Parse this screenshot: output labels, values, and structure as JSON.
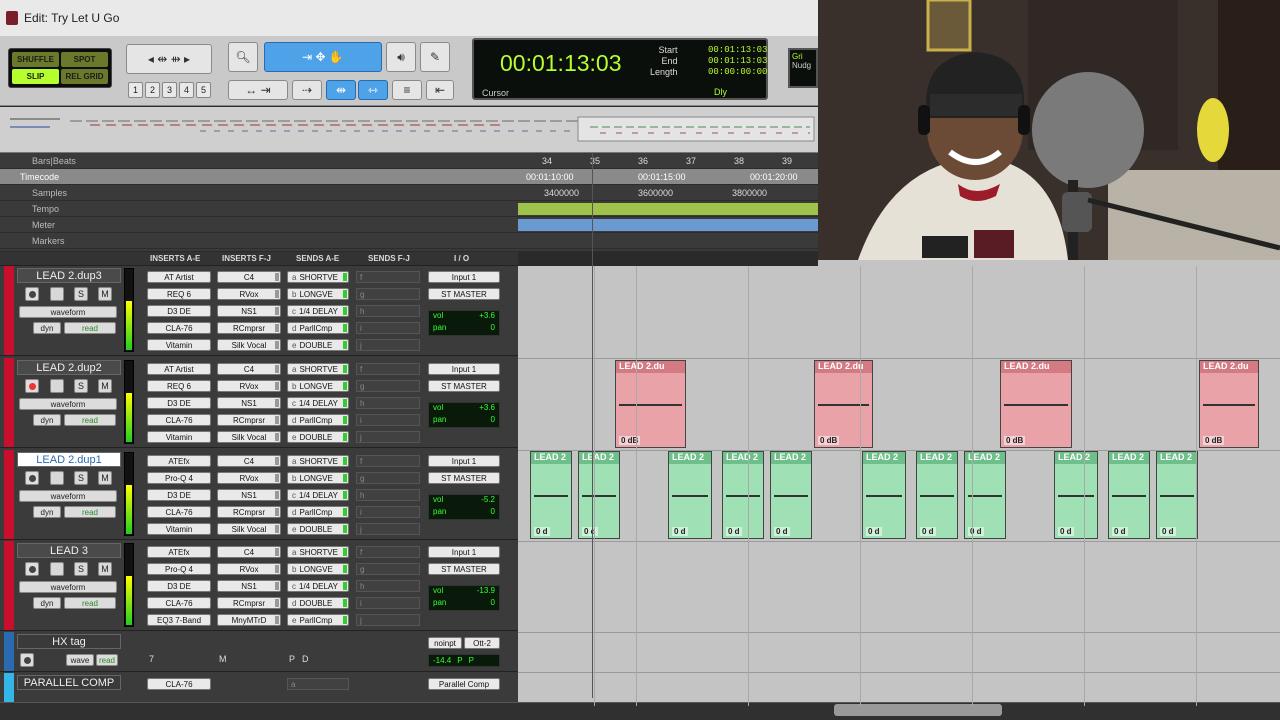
{
  "window": {
    "title": "Edit: Try Let U Go"
  },
  "toolbar": {
    "modes": [
      "SHUFFLE",
      "SPOT",
      "SLIP",
      "REL GRID"
    ],
    "grid_numbers": [
      "1",
      "2",
      "3",
      "4",
      "5"
    ]
  },
  "counter": {
    "main": "00:01:13:03",
    "labels": [
      "Start",
      "End",
      "Length"
    ],
    "values": [
      "00:01:13:03",
      "00:01:13:03",
      "00:00:00:00"
    ],
    "cursor_label": "Cursor",
    "dly_label": "Dly"
  },
  "right_panel": {
    "labels": [
      "Gri",
      "Nudg"
    ]
  },
  "rulers": {
    "rows": [
      "Bars|Beats",
      "Timecode",
      "Samples",
      "Tempo",
      "Meter",
      "Markers"
    ],
    "bars": [
      "34",
      "35",
      "36",
      "37",
      "38",
      "39"
    ],
    "timecodes": [
      "00:01:10:00",
      "00:01:15:00",
      "00:01:20:00"
    ],
    "samples": [
      "3400000",
      "3600000",
      "3800000"
    ]
  },
  "columns": {
    "inserts_ae": "INSERTS A-E",
    "inserts_fj": "INSERTS F-J",
    "sends_ae": "SENDS A-E",
    "sends_fj": "SENDS F-J",
    "io": "I / O"
  },
  "tracks": [
    {
      "name": "LEAD 2.dup3",
      "view": "waveform",
      "dyn": "dyn",
      "auto": "read",
      "ins_a": [
        "AT Artist",
        "REQ 6",
        "D3 DE",
        "CLA-76",
        "Vitamin"
      ],
      "ins_f": [
        "C4",
        "RVox",
        "NS1",
        "RCmprsr",
        "Silk Vocal"
      ],
      "sends": [
        "SHORTVE",
        "LONGVE",
        "1/4 DELAY",
        "ParllCmp",
        "DOUBLE"
      ],
      "send_letters": [
        "a",
        "b",
        "c",
        "d",
        "e"
      ],
      "sends_fj": [
        "f",
        "g",
        "h",
        "i",
        "j"
      ],
      "input": "Input 1",
      "output": "ST MASTER",
      "vol": "+3.6",
      "pan": "0"
    },
    {
      "name": "LEAD 2.dup2",
      "view": "waveform",
      "dyn": "dyn",
      "auto": "read",
      "ins_a": [
        "AT Artist",
        "REQ 6",
        "D3 DE",
        "CLA-76",
        "Vitamin"
      ],
      "ins_f": [
        "C4",
        "RVox",
        "NS1",
        "RCmprsr",
        "Silk Vocal"
      ],
      "sends": [
        "SHORTVE",
        "LONGVE",
        "1/4 DELAY",
        "ParllCmp",
        "DOUBLE"
      ],
      "send_letters": [
        "a",
        "b",
        "c",
        "d",
        "e"
      ],
      "sends_fj": [
        "f",
        "g",
        "h",
        "i",
        "j"
      ],
      "input": "Input 1",
      "output": "ST MASTER",
      "vol": "+3.6",
      "pan": "0"
    },
    {
      "name": "LEAD 2.dup1",
      "view": "waveform",
      "dyn": "dyn",
      "auto": "read",
      "ins_a": [
        "ATEfx",
        "Pro-Q 4",
        "D3 DE",
        "CLA-76",
        "Vitamin"
      ],
      "ins_f": [
        "C4",
        "RVox",
        "NS1",
        "RCmprsr",
        "Silk Vocal"
      ],
      "sends": [
        "SHORTVE",
        "LONGVE",
        "1/4 DELAY",
        "ParllCmp",
        "DOUBLE"
      ],
      "send_letters": [
        "a",
        "b",
        "c",
        "d",
        "e"
      ],
      "sends_fj": [
        "f",
        "g",
        "h",
        "i",
        "j"
      ],
      "input": "Input 1",
      "output": "ST MASTER",
      "vol": "-5.2",
      "pan": "0"
    },
    {
      "name": "LEAD 3",
      "view": "waveform",
      "dyn": "dyn",
      "auto": "read",
      "ins_a": [
        "ATEfx",
        "Pro-Q 4",
        "D3 DE",
        "CLA-76",
        "EQ3 7-Band"
      ],
      "ins_f": [
        "C4",
        "RVox",
        "NS1",
        "RCmprsr",
        "MnyMTrD"
      ],
      "sends": [
        "SHORTVE",
        "LONGVE",
        "1/4 DELAY",
        "DOUBLE",
        "ParllCmp"
      ],
      "send_letters": [
        "a",
        "b",
        "c",
        "d",
        "e"
      ],
      "sends_fj": [
        "f",
        "g",
        "h",
        "i",
        "j"
      ],
      "input": "Input 1",
      "output": "ST MASTER",
      "vol": "-13.9",
      "pan": "0"
    }
  ],
  "hx_track": {
    "name": "HX tag",
    "view": "wave",
    "auto": "read",
    "input": "noinpt",
    "output": "Ott-2",
    "vol": "-14.4",
    "pan_l": "P",
    "pan_r": "P",
    "slot_labels": [
      "7",
      "M",
      "P",
      "D"
    ]
  },
  "parallel_track": {
    "name": "PARALLEL COMP",
    "insert": "CLA-76",
    "output": "Parallel Comp",
    "send_letter": "a"
  },
  "clips": {
    "red_label": "LEAD 2.du",
    "green_label": "LEAD 2",
    "gain": "0 dB",
    "gain_short": "0 d"
  }
}
